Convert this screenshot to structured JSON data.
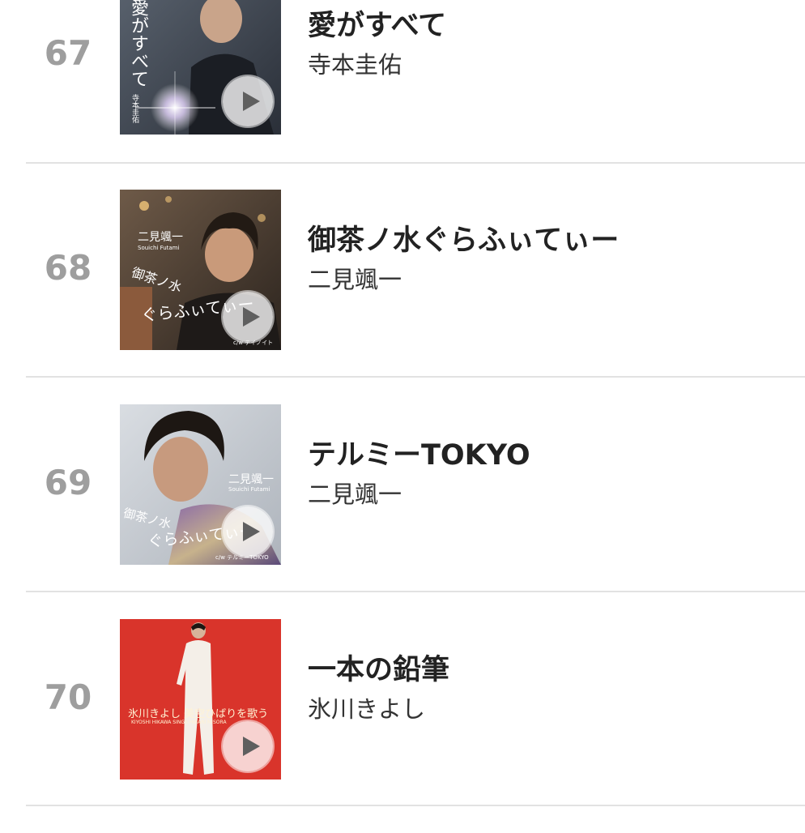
{
  "ranking": [
    {
      "rank": "67",
      "title": "愛がすべて",
      "artist": "寺本圭佑",
      "cover_text": [
        "愛がすべて",
        "寺本圭佑"
      ],
      "cover_bg": "#3a4250"
    },
    {
      "rank": "68",
      "title": "御茶ノ水ぐらふぃてぃー",
      "artist": "二見颯一",
      "cover_text": [
        "二見颯一",
        "Souichi Futami",
        "御茶ノ水",
        "ぐらふぃてぃー",
        "c/w テイノイト"
      ],
      "cover_bg": "#4a3a30"
    },
    {
      "rank": "69",
      "title": "テルミーTOKYO",
      "artist": "二見颯一",
      "cover_text": [
        "二見颯一",
        "Souichi Futami",
        "御茶ノ水",
        "ぐらふぃてぃー",
        "c/w テルミーTOKYO"
      ],
      "cover_bg": "#c8ccd2"
    },
    {
      "rank": "70",
      "title": "一本の鉛筆",
      "artist": "氷川きよし",
      "cover_text": [
        "氷川きよし 美空ひばりを歌う",
        "KIYOSHI HIKAWA SINGS HIBARI MISORA"
      ],
      "cover_bg": "#d9342b"
    }
  ],
  "colors": {
    "rank": "#9e9e9e",
    "title": "#222222",
    "divider": "#e2e2e2"
  },
  "icons": {
    "play": "play-icon"
  }
}
